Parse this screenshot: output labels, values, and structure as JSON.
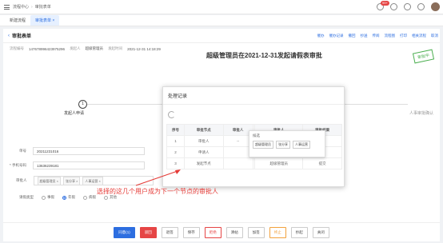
{
  "topbar": {
    "breadcrumb_home": "流程中心",
    "breadcrumb_current": "审批表单",
    "notification_count": "99+"
  },
  "tabs": [
    {
      "label": "新建流程"
    },
    {
      "label": "审批表单 ×"
    }
  ],
  "page": {
    "back_icon": "‹",
    "title": "审批表单",
    "toolbar": [
      "催办",
      "催办记录",
      "撤回",
      "抄送",
      "传阅",
      "流程图",
      "打印",
      "相关流程",
      "取消"
    ]
  },
  "meta": {
    "number_label": "流程编号",
    "number_value": "147678996423975296",
    "applicant_label": "发起人",
    "applicant_value": "超级管理员",
    "time_label": "发起时间",
    "time_value": "2021-12-31 14:18:29"
  },
  "doc_title": "超级管理员在2021-12-31发起请假表审批",
  "stamp": "审批中",
  "steps": [
    {
      "num": "1",
      "label": "发起人申请"
    },
    {
      "label": "人事审批确认"
    }
  ],
  "form": {
    "number_label": "单号",
    "number_value": "20211231016",
    "phone_label": "* 手机号码",
    "phone_value": "13636239181",
    "approver_label": "审批人",
    "approver_chips": [
      "超级管理员 ×",
      "张分享 ×",
      "人事运营 ×"
    ],
    "leave_type_label": "请假类型",
    "leave_types": [
      {
        "label": "事假",
        "checked": false
      },
      {
        "label": "年假",
        "checked": true
      },
      {
        "label": "病假",
        "checked": false
      },
      {
        "label": "其他",
        "checked": false
      }
    ]
  },
  "modal": {
    "title": "处理记录",
    "columns": [
      "序号",
      "审批节点",
      "审批人",
      "",
      "审批人",
      "审批结果"
    ],
    "rows": [
      {
        "no": "1",
        "node": "审批人",
        "c3": "--",
        "c4": "",
        "c5": "",
        "c6": ""
      },
      {
        "no": "2",
        "node": "申请人",
        "c3": "",
        "c4": "",
        "c5": "",
        "c6": ""
      },
      {
        "no": "3",
        "node": "发起节点",
        "c3": "",
        "c4": "",
        "c5": "超级管理员",
        "c6": "提交"
      }
    ],
    "popover_title": "候选",
    "popover_chips": [
      "超级管理员",
      "张分享",
      "人事运营"
    ]
  },
  "annotation": "选择的这几个用户成为下一个节点的审批人",
  "buttons": [
    {
      "label": "同意(1)",
      "style": "primary"
    },
    {
      "label": "驳回",
      "style": "danger"
    },
    {
      "label": "退签",
      "style": "normal"
    },
    {
      "label": "保存",
      "style": "normal"
    },
    {
      "label": "拒绝",
      "style": "danger-o"
    },
    {
      "label": "清帖",
      "style": "normal"
    },
    {
      "label": "加签",
      "style": "normal"
    },
    {
      "label": "终止",
      "style": "warn-o"
    },
    {
      "label": "抄起",
      "style": "normal"
    },
    {
      "label": "关闭",
      "style": "normal"
    }
  ]
}
